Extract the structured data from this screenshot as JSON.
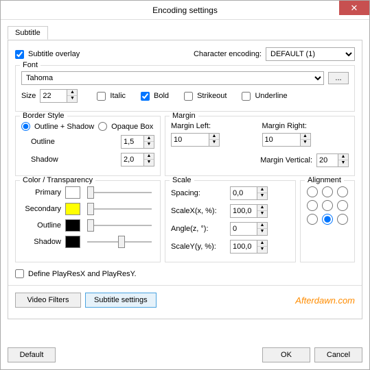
{
  "window": {
    "title": "Encoding settings"
  },
  "tab": {
    "subtitle": "Subtitle"
  },
  "main": {
    "subtitle_overlay_label": "Subtitle overlay",
    "subtitle_overlay_checked": true,
    "char_enc_label": "Character encoding:",
    "char_enc_value": "DEFAULT (1)"
  },
  "font": {
    "legend": "Font",
    "family": "Tahoma",
    "browse": "...",
    "size_label": "Size",
    "size_value": "22",
    "italic": "Italic",
    "italic_checked": false,
    "bold": "Bold",
    "bold_checked": true,
    "strikeout": "Strikeout",
    "strikeout_checked": false,
    "underline": "Underline",
    "underline_checked": false
  },
  "border": {
    "legend": "Border Style",
    "outline_shadow": "Outline + Shadow",
    "opaque_box": "Opaque Box",
    "outline_label": "Outline",
    "outline_value": "1,5",
    "shadow_label": "Shadow",
    "shadow_value": "2,0"
  },
  "margin": {
    "legend": "Margin",
    "left_label": "Margin Left:",
    "left_value": "10",
    "right_label": "Margin Right:",
    "right_value": "10",
    "vertical_label": "Margin Vertical:",
    "vertical_value": "20"
  },
  "color": {
    "legend": "Color / Transparency",
    "primary": "Primary",
    "secondary": "Secondary",
    "outline": "Outline",
    "shadow": "Shadow"
  },
  "scale": {
    "legend": "Scale",
    "spacing_label": "Spacing:",
    "spacing_value": "0,0",
    "scalex_label": "ScaleX(x, %):",
    "scalex_value": "100,0",
    "angle_label": "Angle(z, °):",
    "angle_value": "0",
    "scaley_label": "ScaleY(y, %):",
    "scaley_value": "100,0"
  },
  "alignment": {
    "legend": "Alignment",
    "selected": 7
  },
  "playres": {
    "label": "Define PlayResX and PlayResY.",
    "checked": false
  },
  "buttons": {
    "video_filters": "Video Filters",
    "subtitle_settings": "Subtitle settings",
    "default": "Default",
    "ok": "OK",
    "cancel": "Cancel"
  },
  "watermark": "Afterdawn.com"
}
